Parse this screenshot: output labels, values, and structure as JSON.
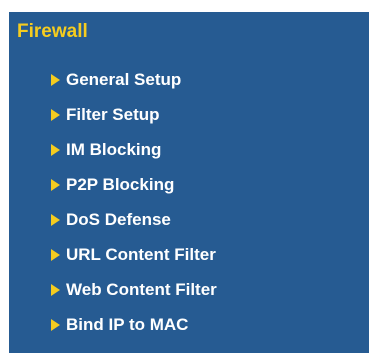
{
  "section": {
    "title": "Firewall"
  },
  "menu": {
    "items": [
      {
        "label": "General Setup"
      },
      {
        "label": "Filter Setup"
      },
      {
        "label": "IM Blocking"
      },
      {
        "label": "P2P Blocking"
      },
      {
        "label": "DoS Defense"
      },
      {
        "label": "URL Content Filter"
      },
      {
        "label": "Web Content Filter"
      },
      {
        "label": "Bind IP to MAC"
      }
    ]
  },
  "colors": {
    "panel_background": "#265b92",
    "title_accent": "#f5cc1f",
    "arrow": "#f5cc1f",
    "item_text": "#ffffff"
  },
  "icons": {
    "bullet": "right-triangle-arrow-icon"
  }
}
